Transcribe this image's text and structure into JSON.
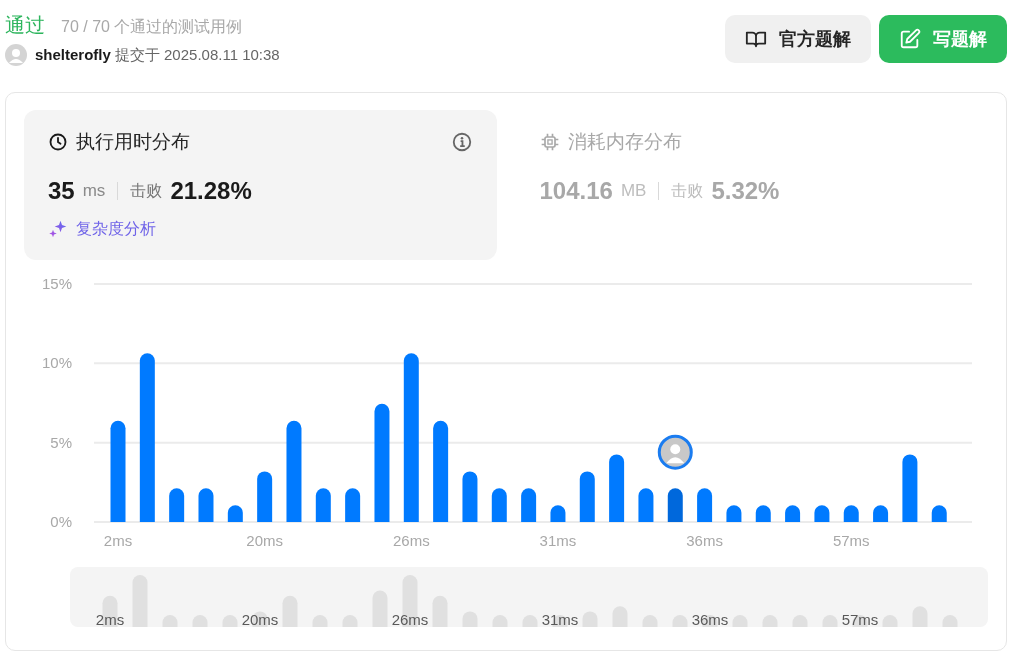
{
  "result": {
    "status": "通过",
    "summary": "70 / 70 个通过的测试用例"
  },
  "submission": {
    "user": "shelterofly",
    "submitted": "提交于 2025.08.11 10:38"
  },
  "buttons": [
    {
      "kind": "official",
      "label": "官方题解"
    },
    {
      "kind": "write",
      "label": "写题解"
    }
  ],
  "tabs": [
    {
      "kind": "runtime",
      "title": "执行用时分布",
      "value": "35",
      "unit": "ms",
      "beats_label": "击败",
      "beats": "21.28%",
      "selected": true,
      "link": "复杂度分析"
    },
    {
      "kind": "memory",
      "title": "消耗内存分布",
      "value": "104.16",
      "unit": "MB",
      "beats_label": "击败",
      "beats": "5.32%",
      "selected": false
    }
  ],
  "chart_data": {
    "type": "bar",
    "categories": [
      "2ms",
      null,
      null,
      null,
      null,
      "20ms",
      null,
      null,
      null,
      null,
      "26ms",
      null,
      null,
      null,
      null,
      "31ms",
      null,
      null,
      null,
      null,
      "36ms",
      null,
      null,
      null,
      null,
      "57ms",
      null,
      null,
      null
    ],
    "values": [
      6.38,
      10.64,
      2.13,
      2.13,
      1.06,
      3.19,
      6.38,
      2.13,
      2.13,
      7.45,
      10.64,
      6.38,
      3.19,
      2.13,
      2.13,
      1.06,
      3.19,
      4.26,
      2.13,
      2.13,
      2.13,
      1.06,
      1.06,
      1.06,
      1.06,
      1.06,
      1.06,
      4.26,
      1.06
    ],
    "ylim": [
      0,
      15
    ],
    "yticks": [
      {
        "value": 0,
        "label": "0%"
      },
      {
        "value": 5,
        "label": "5%"
      },
      {
        "value": 10,
        "label": "10%"
      },
      {
        "value": 15,
        "label": "15%"
      }
    ]
  },
  "bar_states": [
    {
      "selected": false
    },
    {
      "selected": false
    },
    {
      "selected": false
    },
    {
      "selected": false
    },
    {
      "selected": false
    },
    {
      "selected": false
    },
    {
      "selected": false
    },
    {
      "selected": false
    },
    {
      "selected": false
    },
    {
      "selected": false
    },
    {
      "selected": false
    },
    {
      "selected": false
    },
    {
      "selected": false
    },
    {
      "selected": false
    },
    {
      "selected": false
    },
    {
      "selected": false
    },
    {
      "selected": false
    },
    {
      "selected": false
    },
    {
      "selected": false
    },
    {
      "selected": true
    },
    {
      "selected": false
    },
    {
      "selected": false
    },
    {
      "selected": false
    },
    {
      "selected": false
    },
    {
      "selected": false
    },
    {
      "selected": false
    },
    {
      "selected": false
    },
    {
      "selected": false
    },
    {
      "selected": false
    }
  ],
  "overview": {
    "labels": [
      "2ms",
      "20ms",
      "26ms",
      "31ms",
      "36ms",
      "57ms"
    ]
  }
}
